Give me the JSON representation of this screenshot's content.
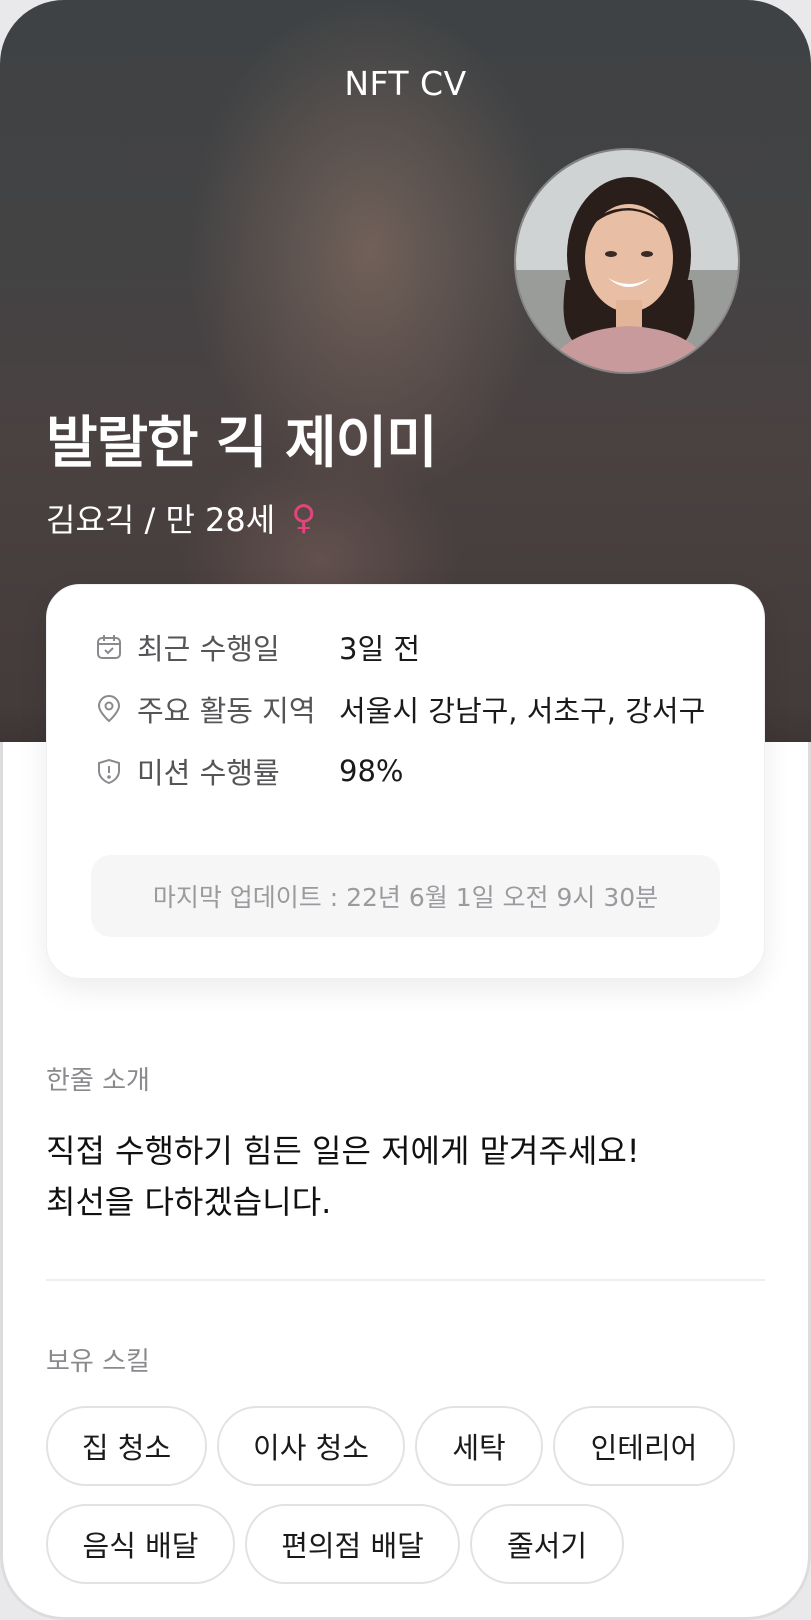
{
  "header": {
    "title": "NFT CV"
  },
  "profile": {
    "nickname": "발랄한 긱 제이미",
    "name_age": "김요긱 / 만 28세",
    "gender_symbol": "♀"
  },
  "info": {
    "rows": [
      {
        "icon": "calendar-icon",
        "label": "최근 수행일",
        "value": "3일 전"
      },
      {
        "icon": "location-pin-icon",
        "label": "주요 활동 지역",
        "value": "서울시 강남구, 서초구, 강서구"
      },
      {
        "icon": "shield-alert-icon",
        "label": "미션 수행률",
        "value": "98%"
      }
    ],
    "last_updated": "마지막 업데이트 : 22년 6월 1일 오전 9시 30분"
  },
  "intro": {
    "title": "한줄 소개",
    "line1": "직접 수행하기 힘든 일은 저에게 맡겨주세요!",
    "line2": "최선을 다하겠습니다."
  },
  "skills": {
    "title": "보유 스킬",
    "items": [
      "집 청소",
      "이사 청소",
      "세탁",
      "인테리어",
      "음식 배달",
      "편의점 배달",
      "줄서기"
    ]
  },
  "colors": {
    "accent_gender": "#e2447c",
    "chip_border": "#e2e2e5",
    "muted_text": "#8a8a8e"
  }
}
